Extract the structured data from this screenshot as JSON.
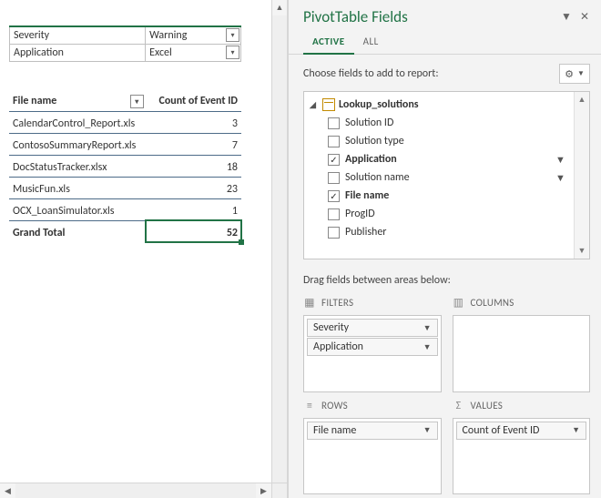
{
  "pane": {
    "title": "PivotTable Fields",
    "tab_active": "ACTIVE",
    "tab_all": "ALL",
    "choose_label": "Choose fields to add to report:",
    "drag_hint": "Drag fields between areas below:",
    "table_name": "Lookup_solutions",
    "fields": {
      "solution_id": {
        "label": "Solution ID",
        "checked": false,
        "filtered": false
      },
      "solution_type": {
        "label": "Solution type",
        "checked": false,
        "filtered": false
      },
      "application": {
        "label": "Application",
        "checked": true,
        "filtered": true
      },
      "solution_name": {
        "label": "Solution name",
        "checked": false,
        "filtered": true
      },
      "file_name": {
        "label": "File name",
        "checked": true,
        "filtered": false
      },
      "prog_id": {
        "label": "ProgID",
        "checked": false,
        "filtered": false
      },
      "publisher": {
        "label": "Publisher",
        "checked": false,
        "filtered": false
      }
    },
    "areas": {
      "filters_label": "FILTERS",
      "columns_label": "COLUMNS",
      "rows_label": "ROWS",
      "values_label": "VALUES",
      "filters": {
        "f0": "Severity",
        "f1": "Application"
      },
      "rows": {
        "r0": "File name"
      },
      "values": {
        "v0": "Count of Event ID"
      }
    }
  },
  "pivot": {
    "filters": {
      "severity_label": "Severity",
      "severity_value": "Warning",
      "application_label": "Application",
      "application_value": "Excel"
    },
    "row_header": "File name",
    "value_header": "Count of Event ID",
    "rows": {
      "r0": {
        "label": "CalendarControl_Report.xls",
        "value": "3"
      },
      "r1": {
        "label": "ContosoSummaryReport.xls",
        "value": "7"
      },
      "r2": {
        "label": "DocStatusTracker.xlsx",
        "value": "18"
      },
      "r3": {
        "label": "MusicFun.xls",
        "value": "23"
      },
      "r4": {
        "label": "OCX_LoanSimulator.xls",
        "value": "1"
      }
    },
    "grand_total_label": "Grand Total",
    "grand_total_value": "52"
  }
}
